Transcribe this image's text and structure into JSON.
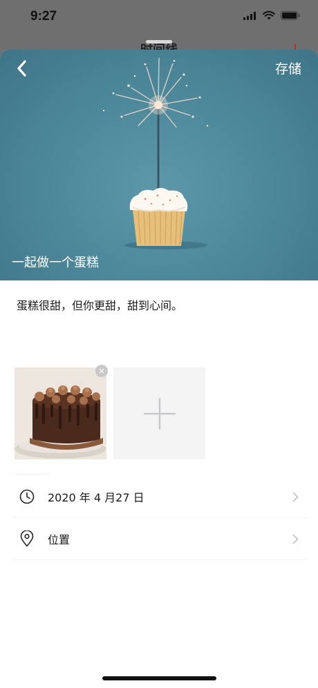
{
  "status_bar": {
    "time": "9:27",
    "icons": [
      "cellular-icon",
      "wifi-icon",
      "battery-icon"
    ]
  },
  "background_screen": {
    "title": "时间线"
  },
  "nav": {
    "back_icon": "chevron-left-icon",
    "save_label": "存储"
  },
  "hero": {
    "title": "一起做一个蛋糕"
  },
  "note": {
    "text": "蛋糕很甜，但你更甜，甜到心间。"
  },
  "photos": {
    "remove_icon_glyph": "×",
    "add_icon": "plus-icon"
  },
  "details": {
    "date_label": "2020 年 4 月27 日",
    "date_icon": "clock-icon",
    "location_label": "位置",
    "location_icon": "location-pin-icon",
    "chevron_icon": "chevron-right-icon"
  },
  "colors": {
    "hero_bg": "#4b8698",
    "sheet_bg": "#ffffff",
    "dim_bg": "#6f6f6f",
    "add_tile_bg": "#f4f4f5"
  }
}
